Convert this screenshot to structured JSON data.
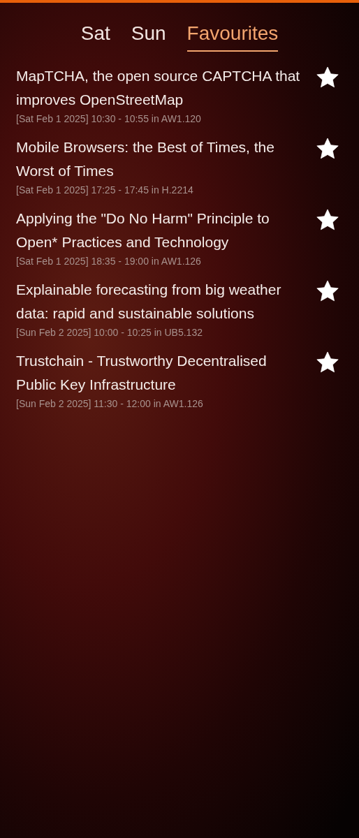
{
  "tabs": [
    {
      "label": "Sat",
      "selected": false
    },
    {
      "label": "Sun",
      "selected": false
    },
    {
      "label": "Favourites",
      "selected": true
    }
  ],
  "talks": [
    {
      "title": "MapTCHA, the open source CAPTCHA that improves OpenStreetMap",
      "details": "[Sat Feb 1 2025] 10:30 - 10:55 in AW1.120",
      "favourite": true
    },
    {
      "title": "Mobile Browsers: the Best of Times, the Worst of Times",
      "details": "[Sat Feb 1 2025] 17:25 - 17:45 in H.2214",
      "favourite": true
    },
    {
      "title": "Applying the \"Do No Harm\" Principle to Open* Practices and Technology",
      "details": "[Sat Feb 1 2025] 18:35 - 19:00 in AW1.126",
      "favourite": true
    },
    {
      "title": "Explainable forecasting from big weather data: rapid and sustainable solutions",
      "details": "[Sun Feb 2 2025] 10:00 - 10:25 in UB5.132",
      "favourite": true
    },
    {
      "title": "Trustchain - Trustworthy Decentralised Public Key Infrastructure",
      "details": "[Sun Feb 2 2025] 11:30 - 12:00 in AW1.126",
      "favourite": true
    }
  ]
}
